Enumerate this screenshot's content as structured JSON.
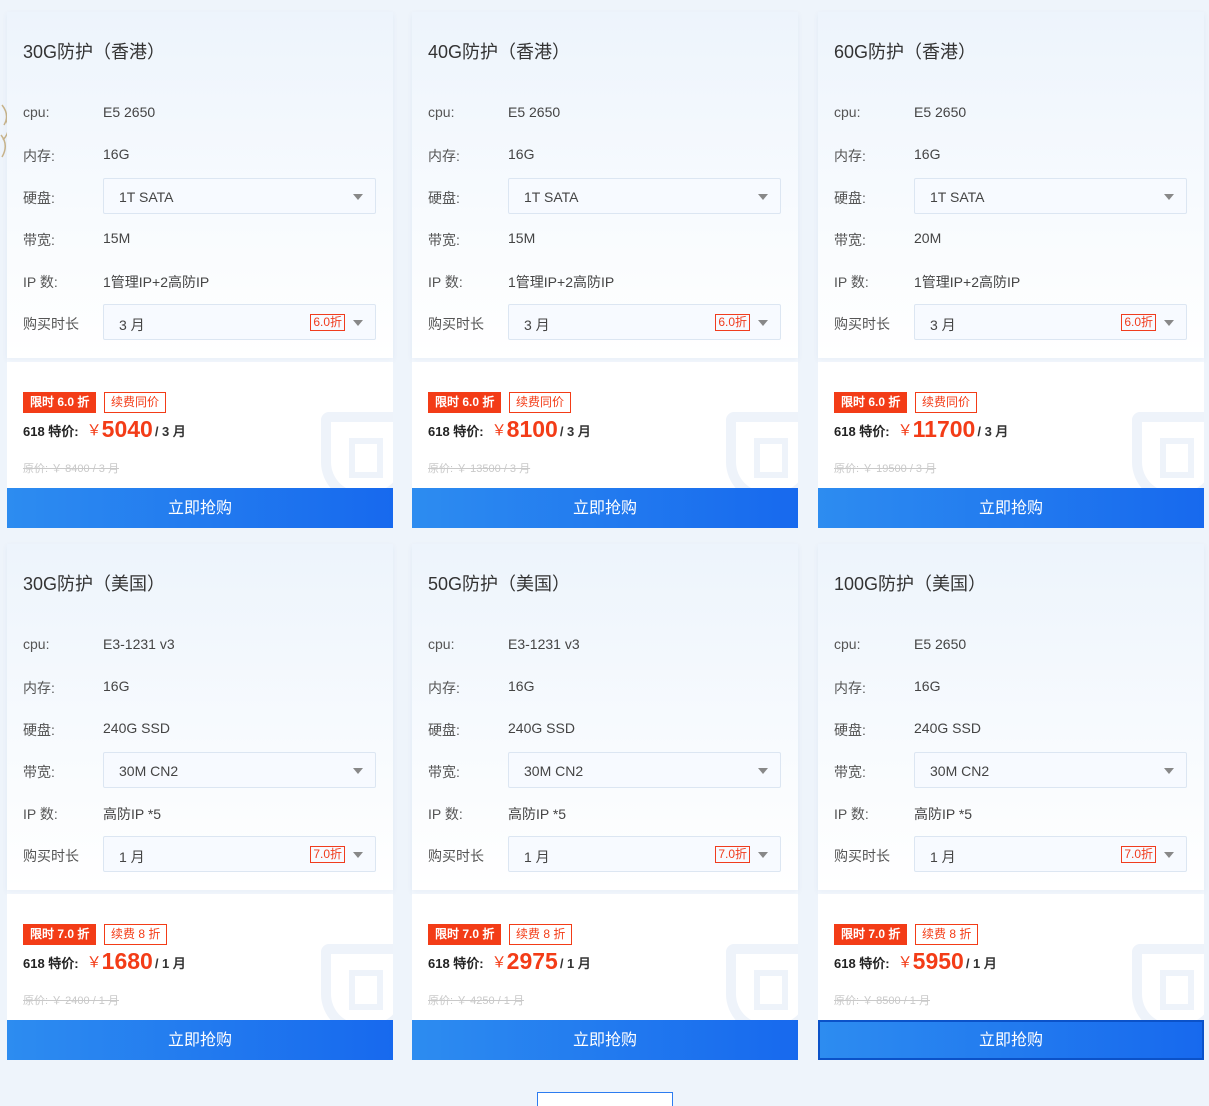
{
  "cards": [
    {
      "title": "30G防护（香港）",
      "rows": [
        {
          "label": "cpu:",
          "value": "E5 2650",
          "type": "text"
        },
        {
          "label": "内存:",
          "value": "16G",
          "type": "text"
        },
        {
          "label": "硬盘:",
          "value": "1T SATA",
          "type": "select"
        },
        {
          "label": "带宽:",
          "value": "15M",
          "type": "text"
        },
        {
          "label": "IP 数:",
          "value": "1管理IP+2高防IP",
          "type": "text"
        },
        {
          "label": "购买时长",
          "value": "3 月",
          "type": "select",
          "discount": "6.0折"
        }
      ],
      "tag_limited": "限时 6.0 折",
      "tag_renew": "续费同价",
      "price_label": "618 特价:",
      "currency": "￥",
      "price": "5040",
      "per": "/ 3 月",
      "original": "原价: ￥ 8400 / 3 月",
      "buy_label": "立即抢购"
    },
    {
      "title": "40G防护（香港）",
      "rows": [
        {
          "label": "cpu:",
          "value": "E5 2650",
          "type": "text"
        },
        {
          "label": "内存:",
          "value": "16G",
          "type": "text"
        },
        {
          "label": "硬盘:",
          "value": "1T SATA",
          "type": "select"
        },
        {
          "label": "带宽:",
          "value": "15M",
          "type": "text"
        },
        {
          "label": "IP 数:",
          "value": "1管理IP+2高防IP",
          "type": "text"
        },
        {
          "label": "购买时长",
          "value": "3 月",
          "type": "select",
          "discount": "6.0折"
        }
      ],
      "tag_limited": "限时 6.0 折",
      "tag_renew": "续费同价",
      "price_label": "618 特价:",
      "currency": "￥",
      "price": "8100",
      "per": "/ 3 月",
      "original": "原价: ￥ 13500 / 3 月",
      "buy_label": "立即抢购"
    },
    {
      "title": "60G防护（香港）",
      "rows": [
        {
          "label": "cpu:",
          "value": "E5 2650",
          "type": "text"
        },
        {
          "label": "内存:",
          "value": "16G",
          "type": "text"
        },
        {
          "label": "硬盘:",
          "value": "1T SATA",
          "type": "select"
        },
        {
          "label": "带宽:",
          "value": "20M",
          "type": "text"
        },
        {
          "label": "IP 数:",
          "value": "1管理IP+2高防IP",
          "type": "text"
        },
        {
          "label": "购买时长",
          "value": "3 月",
          "type": "select",
          "discount": "6.0折"
        }
      ],
      "tag_limited": "限时 6.0 折",
      "tag_renew": "续费同价",
      "price_label": "618 特价:",
      "currency": "￥",
      "price": "11700",
      "per": "/ 3 月",
      "original": "原价: ￥ 19500 / 3 月",
      "buy_label": "立即抢购"
    },
    {
      "title": "30G防护（美国）",
      "rows": [
        {
          "label": "cpu:",
          "value": "E3-1231 v3",
          "type": "text"
        },
        {
          "label": "内存:",
          "value": "16G",
          "type": "text"
        },
        {
          "label": "硬盘:",
          "value": "240G SSD",
          "type": "text"
        },
        {
          "label": "带宽:",
          "value": "30M CN2",
          "type": "select"
        },
        {
          "label": "IP 数:",
          "value": "高防IP *5",
          "type": "text"
        },
        {
          "label": "购买时长",
          "value": "1 月",
          "type": "select",
          "discount": "7.0折"
        }
      ],
      "tag_limited": "限时 7.0 折",
      "tag_renew": "续费 8 折",
      "price_label": "618 特价:",
      "currency": "￥",
      "price": "1680",
      "per": "/ 1 月",
      "original": "原价: ￥ 2400 / 1 月",
      "buy_label": "立即抢购"
    },
    {
      "title": "50G防护（美国）",
      "rows": [
        {
          "label": "cpu:",
          "value": "E3-1231 v3",
          "type": "text"
        },
        {
          "label": "内存:",
          "value": "16G",
          "type": "text"
        },
        {
          "label": "硬盘:",
          "value": "240G SSD",
          "type": "text"
        },
        {
          "label": "带宽:",
          "value": "30M CN2",
          "type": "select"
        },
        {
          "label": "IP 数:",
          "value": "高防IP *5",
          "type": "text"
        },
        {
          "label": "购买时长",
          "value": "1 月",
          "type": "select",
          "discount": "7.0折"
        }
      ],
      "tag_limited": "限时 7.0 折",
      "tag_renew": "续费 8 折",
      "price_label": "618 特价:",
      "currency": "￥",
      "price": "2975",
      "per": "/ 1 月",
      "original": "原价: ￥ 4250 / 1 月",
      "buy_label": "立即抢购"
    },
    {
      "title": "100G防护（美国）",
      "rows": [
        {
          "label": "cpu:",
          "value": "E5 2650",
          "type": "text"
        },
        {
          "label": "内存:",
          "value": "16G",
          "type": "text"
        },
        {
          "label": "硬盘:",
          "value": "240G SSD",
          "type": "text"
        },
        {
          "label": "带宽:",
          "value": "30M CN2",
          "type": "select"
        },
        {
          "label": "IP 数:",
          "value": "高防IP *5",
          "type": "text"
        },
        {
          "label": "购买时长",
          "value": "1 月",
          "type": "select",
          "discount": "7.0折"
        }
      ],
      "tag_limited": "限时 7.0 折",
      "tag_renew": "续费 8 折",
      "price_label": "618 特价:",
      "currency": "￥",
      "price": "5950",
      "per": "/ 1 月",
      "original": "原价: ￥ 8500 / 1 月",
      "buy_label": "立即抢购"
    }
  ],
  "colors": {
    "accent_red": "#f33c17",
    "button_blue": "#1769ee"
  },
  "icons": {
    "dropdown": "chevron-down-icon",
    "watermark": "shield-icon"
  }
}
